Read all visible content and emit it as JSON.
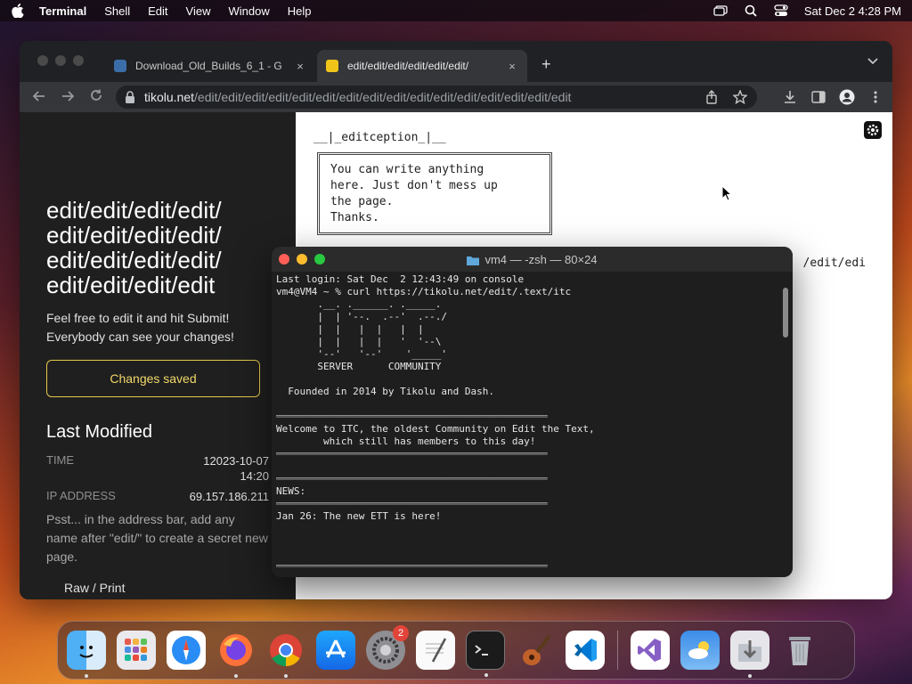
{
  "menubar": {
    "app": "Terminal",
    "items": [
      "Shell",
      "Edit",
      "View",
      "Window",
      "Help"
    ],
    "datetime": "Sat Dec 2  4:28 PM"
  },
  "browser": {
    "tabs": [
      {
        "title": "Download_Old_Builds_6_1 - G",
        "close": "×"
      },
      {
        "title": "edit/edit/edit/edit/edit/edit/",
        "close": "×"
      }
    ],
    "new_tab": "+",
    "url_host": "tikolu.net",
    "url_path": "/edit/edit/edit/edit/edit/edit/edit/edit/edit/edit/edit/edit/edit/edit/edit/edit"
  },
  "sidebar": {
    "title": "edit/edit/edit/edit/ edit/edit/edit/edit/ edit/edit/edit/edit/ edit/edit/edit/edit",
    "desc_1": "Feel free to edit it and hit Submit!",
    "desc_2": "Everybody can see your changes!",
    "saved_button": "Changes saved",
    "last_modified": "Last Modified",
    "time_label": "TIME",
    "time_value_1": "12023-10-07",
    "time_value_2": "14:20",
    "ip_label": "IP ADDRESS",
    "ip_value": "69.157.186.211",
    "psst": "Psst... in the address bar, add any name after \"edit/\" to create a secret new page.",
    "raw_print": "Raw / Print"
  },
  "page": {
    "heading": "__|_editception_|__",
    "box_lines": [
      "You can write anything",
      "here. Just don't mess up",
      "the page.",
      "Thanks."
    ],
    "tail": "/edit/edi"
  },
  "terminal": {
    "title": "vm4 — -zsh — 80×24",
    "lines": [
      "Last login: Sat Dec  2 12:43:49 on console",
      "vm4@VM4 ~ % curl https://tikolu.net/edit/.text/itc",
      "       .__. .______. ._____.",
      "       |  | '--.  .--'  .--./",
      "       |  |   |  |   |  |",
      "       |  |   |  |   '  '--\\",
      "       '--'   '--'    '_____'",
      "       SERVER      COMMUNITY",
      "",
      "  Founded in 2014 by Tikolu and Dash.",
      "",
      "══════════════════════════════════════════════",
      "Welcome to ITC, the oldest Community on Edit the Text,",
      "        which still has members to this day!",
      "══════════════════════════════════════════════",
      "",
      "══════════════════════════════════════════════",
      "NEWS:",
      "══════════════════════════════════════════════",
      "Jan 26: The new ETT is here!",
      "",
      "",
      "",
      "══════════════════════════════════════════════"
    ]
  },
  "dock": {
    "apps": [
      "finder-icon",
      "launchpad-icon",
      "safari-icon",
      "firefox-icon",
      "chrome-icon",
      "app-store-icon",
      "system-settings-icon",
      "textedit-icon",
      "terminal-icon",
      "garageband-icon",
      "vscode-icon",
      "visual-studio-icon",
      "weather-icon",
      "downloads-icon",
      "trash-icon"
    ],
    "settings_badge": "2"
  }
}
